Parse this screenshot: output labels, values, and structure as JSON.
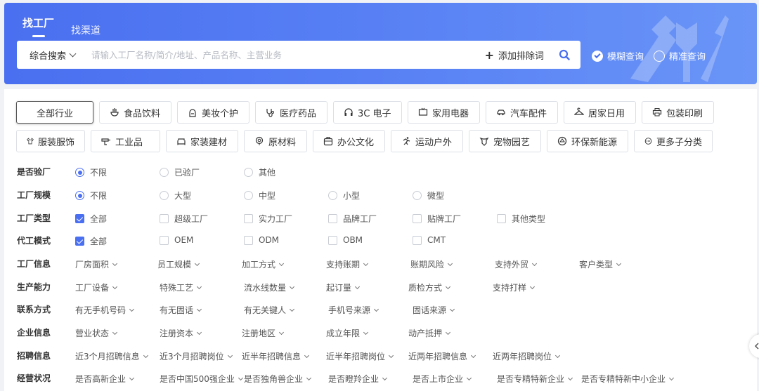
{
  "header": {
    "tabs": [
      {
        "label": "找工厂",
        "active": true
      },
      {
        "label": "找渠道",
        "active": false
      }
    ],
    "search": {
      "scope_label": "综合搜索",
      "placeholder": "请输入工厂名称/简介/地址、产品名称、主营业务",
      "add_exclude_label": "添加排除词"
    },
    "modes": [
      {
        "label": "模糊查询",
        "checked": true
      },
      {
        "label": "精准查询",
        "checked": false
      }
    ]
  },
  "industries": {
    "row1": [
      {
        "label": "全部行业",
        "icon": "none",
        "active": true
      },
      {
        "label": "食品饮料",
        "icon": "hand-bowl-icon"
      },
      {
        "label": "美妆个护",
        "icon": "lipstick-icon"
      },
      {
        "label": "医疗药品",
        "icon": "stethoscope-icon"
      },
      {
        "label": "3C 电子",
        "icon": "headphones-icon"
      },
      {
        "label": "家用电器",
        "icon": "tv-icon"
      },
      {
        "label": "汽车配件",
        "icon": "car-icon"
      },
      {
        "label": "居家日用",
        "icon": "hanger-icon"
      },
      {
        "label": "包装印刷",
        "icon": "printer-icon"
      }
    ],
    "row2": [
      {
        "label": "服装服饰",
        "icon": "shirt-icon"
      },
      {
        "label": "工业品",
        "icon": "drill-icon"
      },
      {
        "label": "家装建材",
        "icon": "sofa-icon"
      },
      {
        "label": "原材料",
        "icon": "wood-icon"
      },
      {
        "label": "办公文化",
        "icon": "briefcase-icon"
      },
      {
        "label": "运动户外",
        "icon": "runner-icon"
      },
      {
        "label": "宠物园艺",
        "icon": "pet-icon"
      },
      {
        "label": "环保新能源",
        "icon": "recycle-icon"
      },
      {
        "label": "更多子分类",
        "icon": "more-icon"
      }
    ]
  },
  "filters": {
    "verified": {
      "label": "是否验厂",
      "options": [
        "不限",
        "已验厂",
        "其他"
      ],
      "selected": 0
    },
    "scale": {
      "label": "工厂规模",
      "options": [
        "不限",
        "大型",
        "中型",
        "小型",
        "微型"
      ],
      "selected": 0
    },
    "type": {
      "label": "工厂类型",
      "options": [
        "全部",
        "超级工厂",
        "实力工厂",
        "品牌工厂",
        "贴牌工厂",
        "其他类型"
      ],
      "checked": [
        0
      ]
    },
    "oem": {
      "label": "代工模式",
      "options": [
        "全部",
        "OEM",
        "ODM",
        "OBM",
        "CMT"
      ],
      "checked": [
        0
      ]
    },
    "info": {
      "label": "工厂信息",
      "dropdowns": [
        "厂房面积",
        "员工规模",
        "加工方式",
        "支持账期",
        "账期风险",
        "支持外贸",
        "客户类型"
      ]
    },
    "capacity": {
      "label": "生产能力",
      "dropdowns": [
        "工厂设备",
        "特殊工艺",
        "流水线数量",
        "起订量",
        "质检方式",
        "支持打样"
      ]
    },
    "contact": {
      "label": "联系方式",
      "dropdowns": [
        "有无手机号码",
        "有无固话",
        "有无关键人",
        "手机号来源",
        "固话来源"
      ]
    },
    "company": {
      "label": "企业信息",
      "dropdowns": [
        "营业状态",
        "注册资本",
        "注册地区",
        "成立年限",
        "动产抵押"
      ]
    },
    "hiring": {
      "label": "招聘信息",
      "dropdowns": [
        "近3个月招聘信息",
        "近3个月招聘岗位",
        "近半年招聘信息",
        "近半年招聘岗位",
        "近两年招聘信息",
        "近两年招聘岗位"
      ]
    },
    "business": {
      "label": "经营状况",
      "dropdowns": [
        "是否高新企业",
        "是否中国500强企业",
        "是否独角兽企业",
        "是否瞪羚企业",
        "是否上市企业",
        "是否专精特新企业",
        "是否专精特新中小企业"
      ]
    }
  },
  "colors": {
    "accent": "#4a6ff0",
    "header_bg": "#5b84f5"
  }
}
